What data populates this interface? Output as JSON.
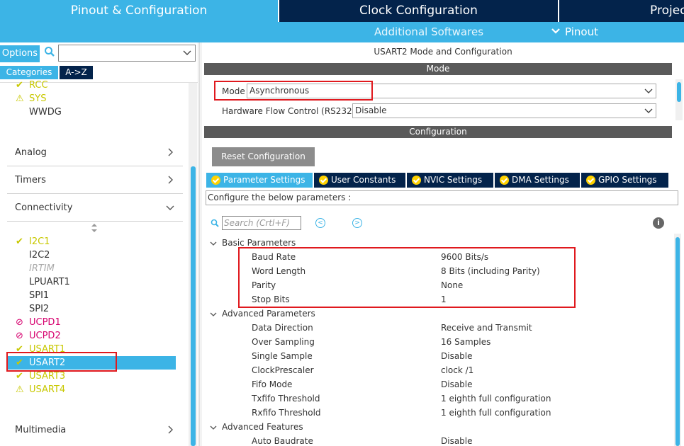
{
  "top_tabs": {
    "pinout": "Pinout & Configuration",
    "clock": "Clock Configuration",
    "project": "Projec"
  },
  "sub_bar": {
    "additional": "Additional Softwares",
    "pinout": "Pinout"
  },
  "left": {
    "options_label": "Options",
    "search_value": "",
    "categories_label": "Categories",
    "az_label": "A->Z",
    "system_items": [
      {
        "mark": "✔",
        "label": "RCC",
        "status": "ok"
      },
      {
        "mark": "⚠",
        "label": "SYS",
        "status": "warning"
      },
      {
        "mark": "",
        "label": "WWDG",
        "status": "none"
      }
    ],
    "categories": {
      "analog": "Analog",
      "timers": "Timers",
      "connectivity": "Connectivity",
      "multimedia": "Multimedia"
    },
    "connectivity_items": [
      {
        "mark": "✔",
        "label": "I2C1",
        "status": "ok"
      },
      {
        "mark": "",
        "label": "I2C2",
        "status": "none"
      },
      {
        "mark": "",
        "label": "IRTIM",
        "status": "disabled"
      },
      {
        "mark": "",
        "label": "LPUART1",
        "status": "none"
      },
      {
        "mark": "",
        "label": "SPI1",
        "status": "none"
      },
      {
        "mark": "",
        "label": "SPI2",
        "status": "none"
      },
      {
        "mark": "⊘",
        "label": "UCPD1",
        "status": "blocked"
      },
      {
        "mark": "⊘",
        "label": "UCPD2",
        "status": "blocked"
      },
      {
        "mark": "✔",
        "label": "USART1",
        "status": "ok"
      },
      {
        "mark": "✔",
        "label": "USART2",
        "status": "selected"
      },
      {
        "mark": "✔",
        "label": "USART3",
        "status": "ok"
      },
      {
        "mark": "⚠",
        "label": "USART4",
        "status": "warning"
      }
    ]
  },
  "right": {
    "title": "USART2 Mode and Configuration",
    "mode_band": "Mode",
    "mode_label": "Mode",
    "mode_value": "Asynchronous",
    "hw_flow_label": "Hardware Flow Control (RS232)",
    "hw_flow_value": "Disable",
    "config_band": "Configuration",
    "reset_label": "Reset Configuration",
    "tabs": [
      "Parameter Settings",
      "User Constants",
      "NVIC Settings",
      "DMA Settings",
      "GPIO Settings"
    ],
    "note": "Configure the below parameters :",
    "search_placeholder": "Search (Crtl+F)",
    "info": "i",
    "groups": {
      "basic": "Basic Parameters",
      "advanced": "Advanced Parameters",
      "features": "Advanced Features"
    },
    "basic_params": [
      {
        "name": "Baud Rate",
        "value": "9600 Bits/s"
      },
      {
        "name": "Word Length",
        "value": "8 Bits (including Parity)"
      },
      {
        "name": "Parity",
        "value": "None"
      },
      {
        "name": "Stop Bits",
        "value": "1"
      }
    ],
    "advanced_params": [
      {
        "name": "Data Direction",
        "value": "Receive and Transmit"
      },
      {
        "name": "Over Sampling",
        "value": "16 Samples"
      },
      {
        "name": "Single Sample",
        "value": "Disable"
      },
      {
        "name": "ClockPrescaler",
        "value": "clock /1"
      },
      {
        "name": "Fifo Mode",
        "value": "Disable"
      },
      {
        "name": "Txfifo Threshold",
        "value": "1 eighth full configuration"
      },
      {
        "name": "Rxfifo Threshold",
        "value": "1 eighth full configuration"
      }
    ],
    "feature_params": [
      {
        "name": "Auto Baudrate",
        "value": "Disable"
      }
    ]
  },
  "colors": {
    "accent": "#3cb4e6",
    "navy": "#03234b",
    "warning": "#c8c800",
    "blocked": "#d6006e",
    "highlight": "#e0191e"
  }
}
